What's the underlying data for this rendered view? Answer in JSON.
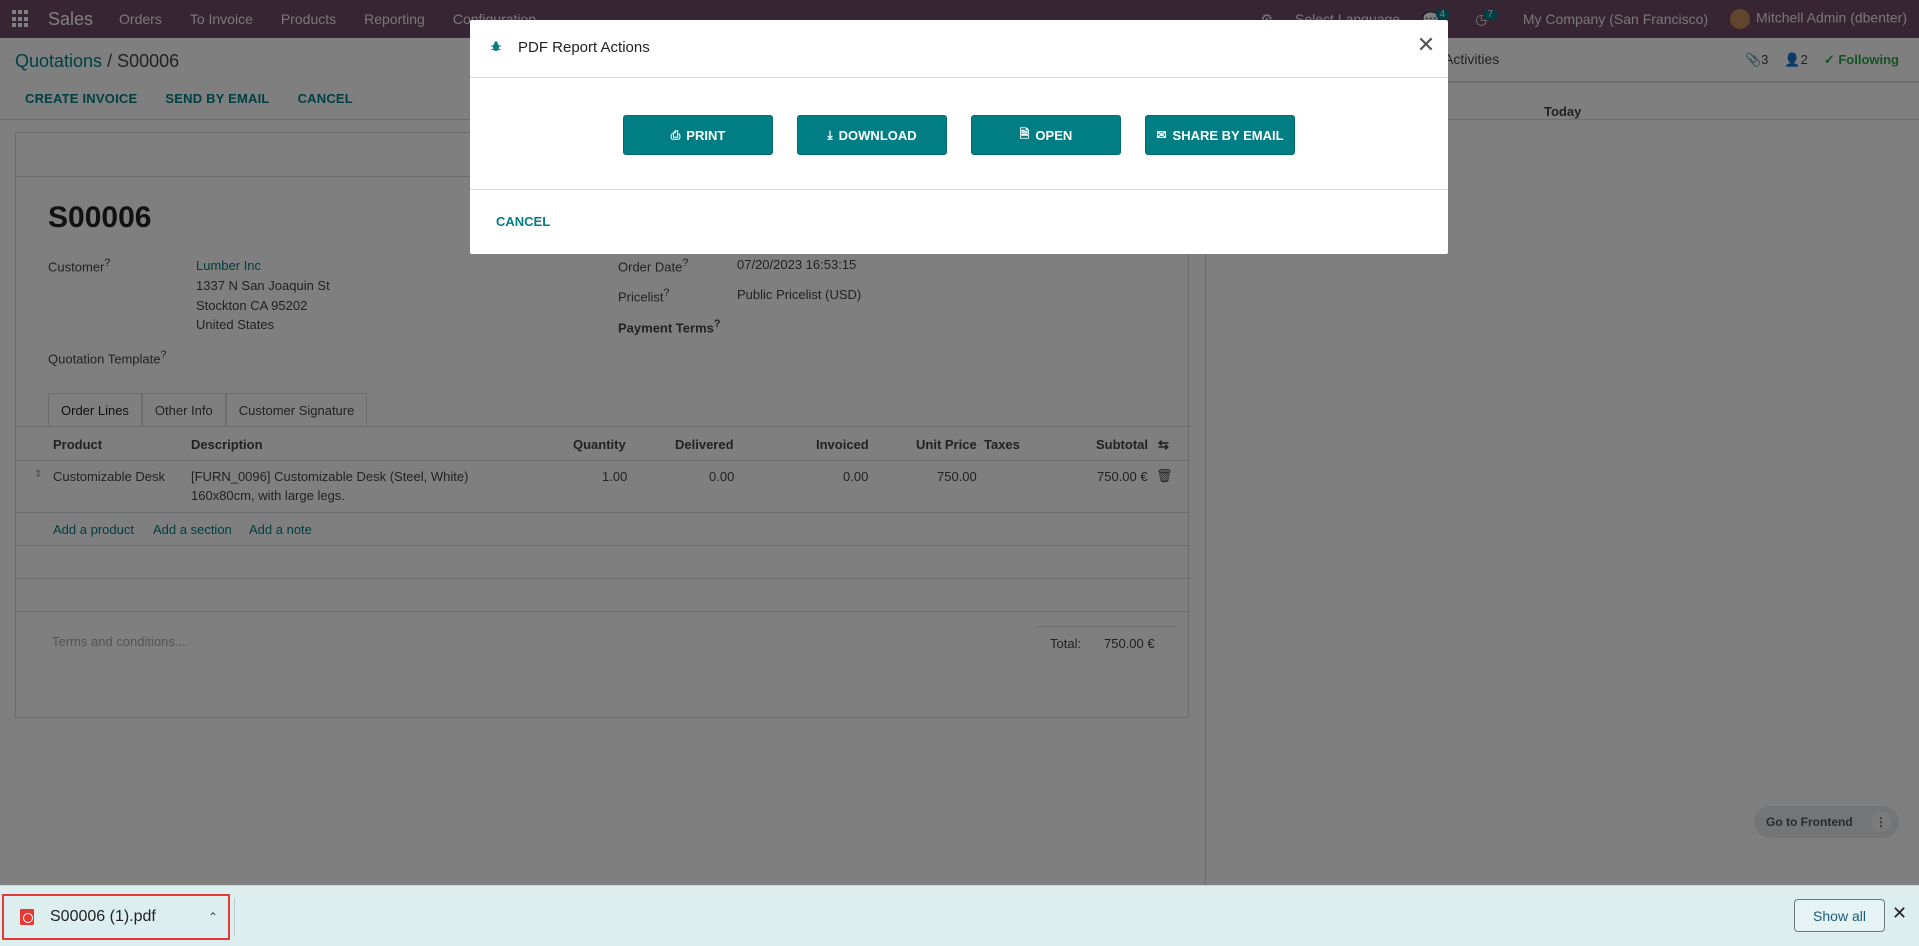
{
  "topbar": {
    "app_name": "Sales",
    "menu": [
      "Orders",
      "To Invoice",
      "Products",
      "Reporting",
      "Configuration"
    ],
    "language": "Select Language",
    "messages_count": "4",
    "activities_count": "7",
    "company": "My Company (San Francisco)",
    "user": "Mitchell Admin (dbenter)"
  },
  "breadcrumb": {
    "parent": "Quotations",
    "separator": "/",
    "current": "S00006"
  },
  "actions": {
    "create_invoice": "CREATE INVOICE",
    "send_by_email": "SEND BY EMAIL",
    "cancel": "CANCEL"
  },
  "chatter": {
    "activities": "Activities",
    "attachments": "3",
    "followers": "2",
    "following": "Following",
    "today": "Today"
  },
  "record": {
    "name": "S00006",
    "customer_label": "Customer",
    "customer": "Lumber Inc",
    "address": [
      "1337 N San Joaquin St",
      "Stockton CA 95202",
      "United States"
    ],
    "template_label": "Quotation Template",
    "order_date_label": "Order Date",
    "order_date": "07/20/2023 16:53:15",
    "pricelist_label": "Pricelist",
    "pricelist": "Public Pricelist (USD)",
    "payment_terms_label": "Payment Terms",
    "help_mark": "?"
  },
  "tabs": [
    "Order Lines",
    "Other Info",
    "Customer Signature"
  ],
  "table": {
    "headers": {
      "product": "Product",
      "description": "Description",
      "quantity": "Quantity",
      "delivered": "Delivered",
      "invoiced": "Invoiced",
      "unit_price": "Unit Price",
      "taxes": "Taxes",
      "subtotal": "Subtotal"
    },
    "row": {
      "product": "Customizable Desk",
      "description_1": "[FURN_0096] Customizable Desk (Steel, White)",
      "description_2": "160x80cm, with large legs.",
      "quantity": "1.00",
      "delivered": "0.00",
      "invoiced": "0.00",
      "unit_price": "750.00",
      "subtotal": "750.00 €"
    },
    "add_product": "Add a product",
    "add_section": "Add a section",
    "add_note": "Add a note"
  },
  "footer": {
    "terms_placeholder": "Terms and conditions...",
    "total_label": "Total:",
    "total_value": "750.00 €"
  },
  "modal": {
    "title": "PDF Report Actions",
    "buttons": {
      "print": "PRINT",
      "download": "DOWNLOAD",
      "open": "OPEN",
      "share": "SHARE BY EMAIL"
    },
    "cancel": "CANCEL"
  },
  "goto_frontend": "Go to Frontend",
  "download_bar": {
    "file_name": "S00006 (1).pdf",
    "show_all": "Show all"
  },
  "colors": {
    "brand": "#714b67",
    "accent": "#017e84",
    "highlight": "#e53935"
  }
}
